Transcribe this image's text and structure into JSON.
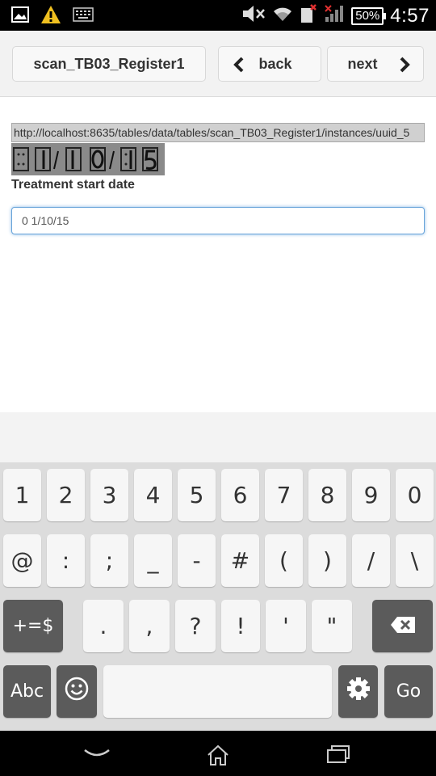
{
  "status_bar": {
    "time": "4:57",
    "battery": "50%",
    "icons_left": [
      "image-icon",
      "warning-icon",
      "keyboard-icon"
    ],
    "icons_right": [
      "mute-icon",
      "wifi-icon",
      "sim-icon",
      "signal-icon"
    ]
  },
  "header": {
    "form_name": "scan_TB03_Register1",
    "back_label": "back",
    "next_label": "next"
  },
  "form": {
    "url": "http://localhost:8635/tables/data/tables/scan_TB03_Register1/instances/uuid_5",
    "field_label": "Treatment start date",
    "date_value": "0 1/10/15"
  },
  "keyboard": {
    "row1": [
      "1",
      "2",
      "3",
      "4",
      "5",
      "6",
      "7",
      "8",
      "9",
      "0"
    ],
    "row2": [
      "@",
      ":",
      ";",
      "_",
      "-",
      "#",
      "(",
      ")",
      "/",
      "\\"
    ],
    "row3_mode": "+=$",
    "row3": [
      ".",
      ",",
      "?",
      "!",
      "'",
      "\""
    ],
    "abc_label": "Abc",
    "go_label": "Go"
  },
  "colors": {
    "status_bar": "#000000",
    "header_bg": "#f2f2f2",
    "input_focus_border": "#67a3d9",
    "keyboard_bg": "#dcdcdc",
    "dark_key": "#5b5b5b"
  }
}
